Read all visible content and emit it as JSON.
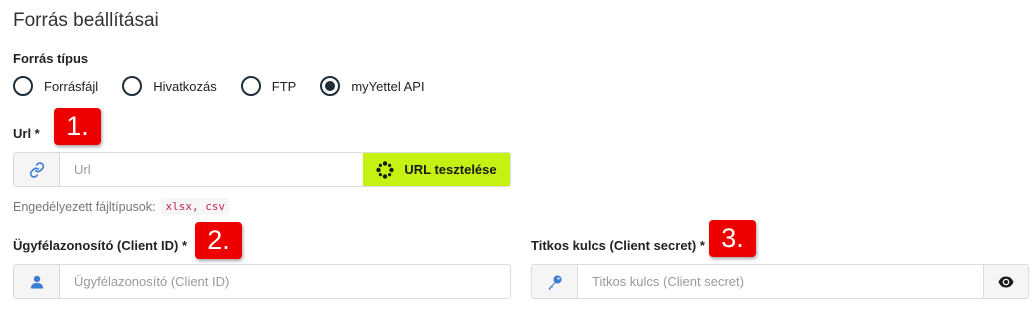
{
  "section_title": "Forrás beállításai",
  "source_type": {
    "label": "Forrás típus",
    "options": [
      {
        "label": "Forrásfájl",
        "selected": false
      },
      {
        "label": "Hivatkozás",
        "selected": false
      },
      {
        "label": "FTP",
        "selected": false
      },
      {
        "label": "myYettel API",
        "selected": true
      }
    ]
  },
  "url": {
    "label": "Url *",
    "placeholder": "Url",
    "value": "",
    "icon": "link-icon",
    "test_button_label": "URL tesztelése",
    "hint_text": "Engedélyezett fájltípusok:",
    "allowed_types": "xlsx, csv"
  },
  "client_id": {
    "label": "Ügyfélazonosító (Client ID) *",
    "placeholder": "Ügyfélazonosító (Client ID)",
    "value": "",
    "icon": "user-icon"
  },
  "client_secret": {
    "label": "Titkos kulcs (Client secret) *",
    "placeholder": "Titkos kulcs (Client secret)",
    "value": "",
    "icon": "key-icon",
    "toggle_icon": "eye-icon"
  },
  "annotations": [
    "1.",
    "2.",
    "3."
  ],
  "colors": {
    "accent_button": "#c5f211",
    "annotation_badge": "#ee0000",
    "icon_blue": "#3a7bd5",
    "radio_dark": "#1f2d3a"
  }
}
